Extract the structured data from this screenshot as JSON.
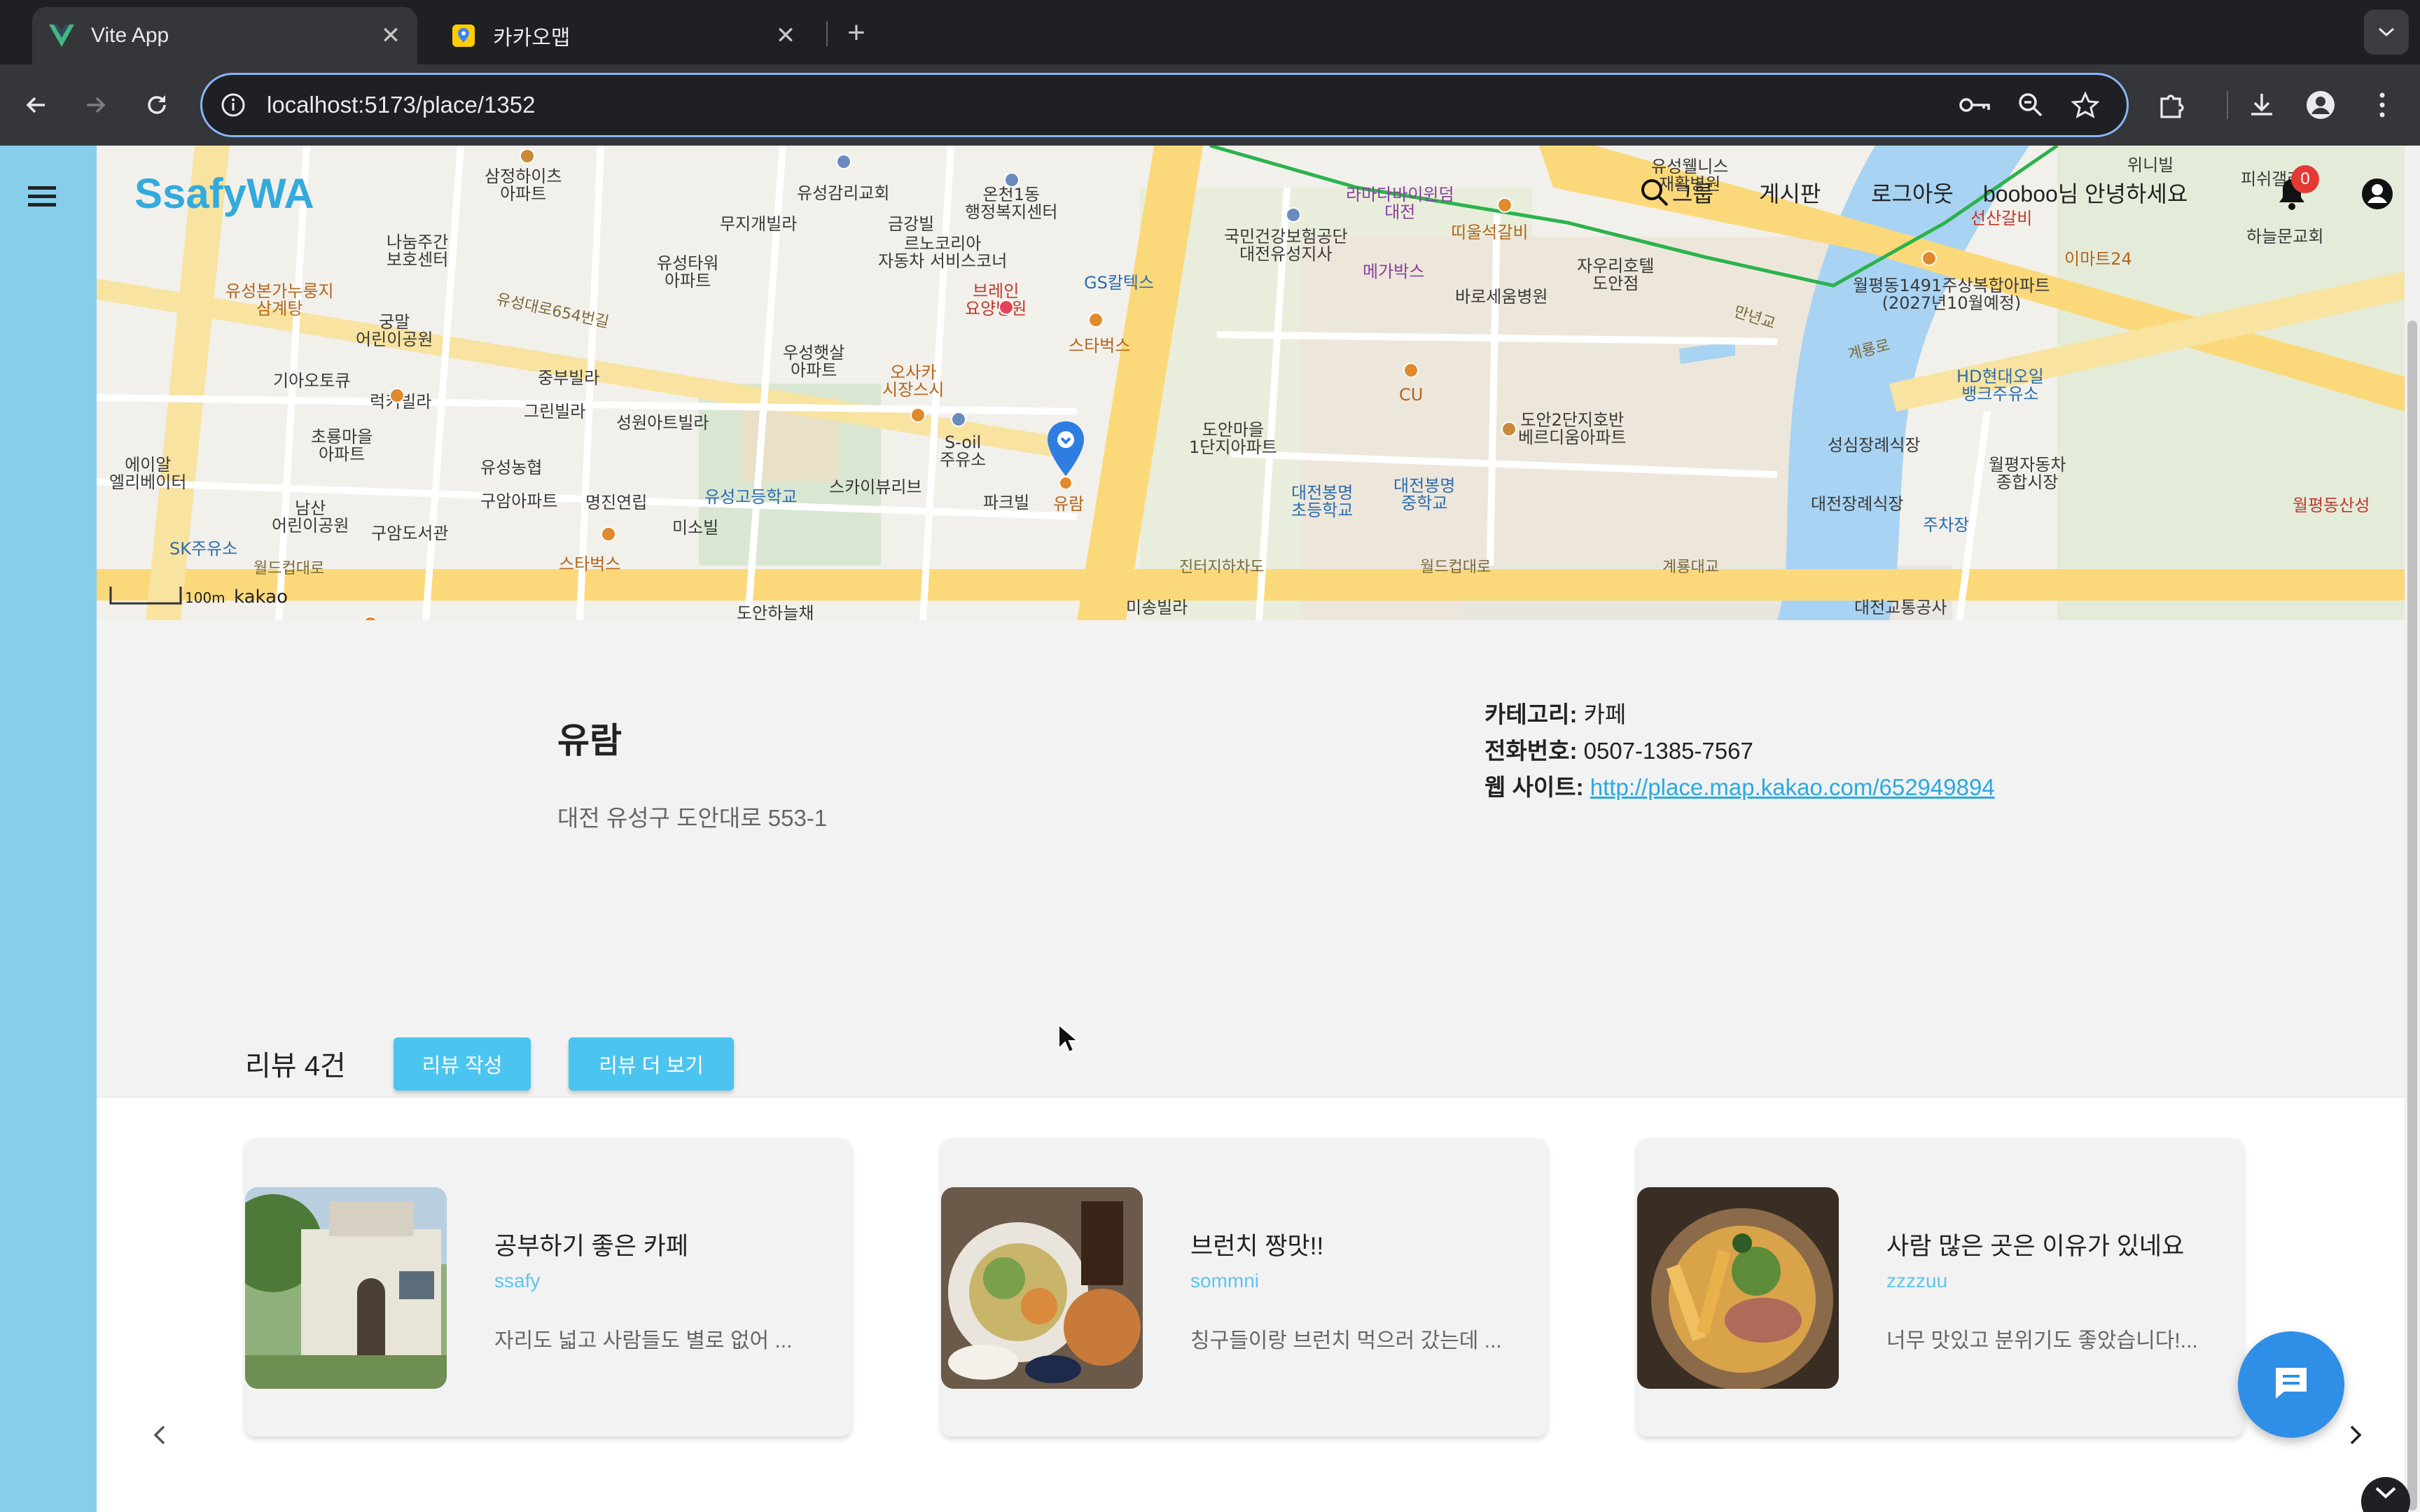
{
  "browser": {
    "tabs": [
      {
        "title": "Vite App",
        "active": true,
        "favicon": "vue-logo-icon"
      },
      {
        "title": "카카오맵",
        "active": false,
        "favicon": "kakaomap-pin-icon"
      }
    ],
    "url": "localhost:5173/place/1352"
  },
  "header": {
    "brand": "SsafyWA",
    "nav": [
      "그룹",
      "게시판",
      "로그아웃"
    ],
    "greeting": "booboo님 안녕하세요",
    "notification_count": "0"
  },
  "map": {
    "scale_label": "100m",
    "provider": "kakao",
    "marker_label": "유람",
    "labels": {
      "l1": "삼정하이츠\n아파트",
      "l2": "유성감리교회",
      "l3": "온천1동\n행정복지센터",
      "l4": "라마다바이윈덤\n대전",
      "l5": "유성웰니스\n재활병원",
      "l6": "위니빌",
      "l7": "피쉬갤러리",
      "l8": "하늘문교회",
      "l9": "나눔주간\n보호센터",
      "l10": "무지개빌라",
      "l11": "금강빌",
      "l12": "르노코리아\n자동차 서비스코너",
      "l13": "국민건강보험공단\n대전유성지사",
      "l14": "띠울석갈비",
      "l15": "메가박스",
      "l16": "바로세움병원",
      "l17": "자우리호텔\n도안점",
      "l18": "선산갈비",
      "l19": "이마트24",
      "l20": "월평동1491주상복합아파트\n(2027년10월예정)",
      "l21": "유성본가누룽지\n삼계탕",
      "l22": "궁말\n어린이공원",
      "l23": "유성타워\n아파트",
      "l24": "GS칼텍스",
      "l25": "브레인\n요양병원",
      "l26": "스타벅스",
      "l27": "우성햇살\n아파트",
      "l28": "오사카\n시장스시",
      "l29": "기아오토큐",
      "l30": "중부빌라",
      "l31": "럭키빌라",
      "l32": "그린빌라",
      "l33": "성원아트빌라",
      "l34": "S-oil\n주유소",
      "l35": "CU",
      "l36": "도안마을\n1단지아파트",
      "l37": "도안2단지호반\n베르디움아파트",
      "l38": "HD현대오일\n뱅크주유소",
      "l39": "성심장례식장",
      "l40": "초룡마을\n아파트",
      "l41": "유성농협",
      "l42": "구암아파트",
      "l43": "명진연립",
      "l44": "유성고등학교",
      "l45": "스카이뷰리브",
      "l46": "파크빌",
      "l47": "대전봉명\n초등학교",
      "l48": "대전봉명\n중학교",
      "l49": "대전장례식장",
      "l50": "주차장",
      "l51": "월평자동차\n종합시장",
      "l52": "월평동산성",
      "l53": "에이알\n엘리베이터",
      "l54": "남산\n어린이공원",
      "l55": "구암도서관",
      "l56": "미소빌",
      "l57": "SK주유소",
      "l58": "월드컵대로",
      "l59": "스타벅스",
      "l60": "진터지하차도",
      "l61": "월드컵대로",
      "l62": "계룡대교",
      "l63": "미송빌라",
      "l64": "도안하늘채",
      "l65": "대전교통공사",
      "l66": "유성대로654번길",
      "l67": "만년교",
      "l68": "계룡로"
    }
  },
  "place": {
    "name": "유람",
    "address": "대전 유성구 도안대로 553-1",
    "category_label": "카테고리:",
    "category": "카페",
    "phone_label": "전화번호:",
    "phone": "0507-1385-7567",
    "website_label": "웹 사이트:",
    "website": "http://place.map.kakao.com/652949894"
  },
  "reviews": {
    "title": "리뷰 4건",
    "write_label": "리뷰 작성",
    "more_label": "리뷰 더 보기",
    "items": [
      {
        "title": "공부하기 좋은 카페",
        "author": "ssafy",
        "excerpt": "자리도 넓고 사람들도 별로 없어 ..."
      },
      {
        "title": "브런치 짱맛!!",
        "author": "sommni",
        "excerpt": "칭구들이랑 브런치 먹으러 갔는데 ..."
      },
      {
        "title": "사람 많은 곳은 이유가 있네요",
        "author": "zzzzuu",
        "excerpt": "너무 맛있고 분위기도 좋았습니다!..."
      }
    ]
  },
  "colors": {
    "sidebar": "#87ceeb",
    "brand": "#34aadc",
    "button": "#4cc4f0",
    "link": "#29a9e1",
    "chat_fab": "#2f8fe6"
  }
}
